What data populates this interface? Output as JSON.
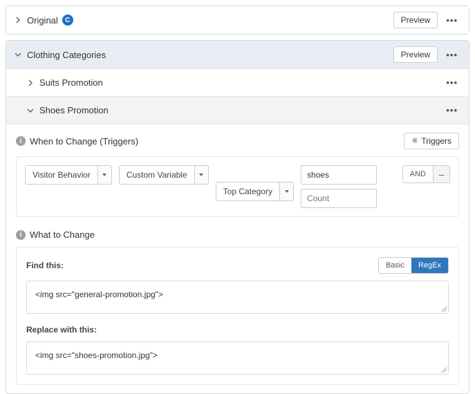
{
  "original": {
    "title": "Original",
    "badge": "C",
    "preview": "Preview"
  },
  "clothing": {
    "title": "Clothing Categories",
    "preview": "Preview",
    "suits": {
      "title": "Suits Promotion"
    },
    "shoes": {
      "title": "Shoes Promotion"
    }
  },
  "triggers": {
    "heading": "When to Change (Triggers)",
    "button": "Triggers",
    "visitorBehavior": "Visitor Behavior",
    "customVariable": "Custom Variable",
    "topCategory": "Top Category",
    "valueInput": "shoes",
    "countPlaceholder": "Count",
    "and": "AND",
    "minus": "–"
  },
  "what": {
    "heading": "What to Change",
    "findLabel": "Find this:",
    "basic": "Basic",
    "regex": "RegEx",
    "findValue": "<img src=\"general-promotion.jpg\">",
    "replaceLabel": "Replace with this:",
    "replaceValue": "<img src=\"shoes-promotion.jpg\">"
  }
}
